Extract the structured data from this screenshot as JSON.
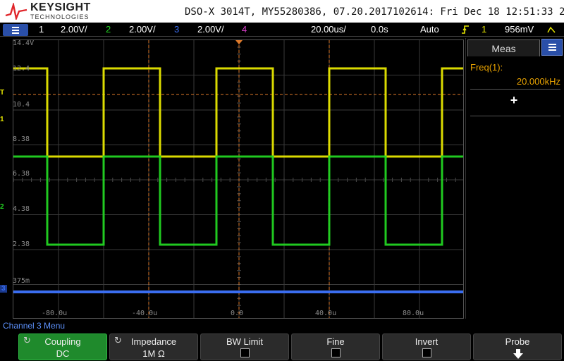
{
  "header": {
    "brand": "KEYSIGHT",
    "brand_sub": "TECHNOLOGIES",
    "title": "DSO-X 3014T, MY55280386, 07.20.2017102614: Fri Dec 18 12:51:33 2020"
  },
  "status": {
    "ch1_num": "1",
    "ch1_scale": "2.00V/",
    "ch2_num": "2",
    "ch2_scale": "2.00V/",
    "ch3_num": "3",
    "ch3_scale": "2.00V/",
    "ch4_num": "4",
    "timebase": "20.00us/",
    "delay": "0.0s",
    "trigger_mode": "Auto",
    "trigger_icon": "trigger-edge-icon",
    "trigger_source": "1",
    "trigger_level": "956mV"
  },
  "colors": {
    "ch1": "#e6e600",
    "ch2": "#22d422",
    "ch3": "#3a6df0",
    "ch4": "#e040d0",
    "accent": "#e8a200",
    "menu_blue": "#2a4fa8"
  },
  "graticule": {
    "y_labels": [
      "14.4V",
      "12.4",
      "10.4",
      "8.38",
      "6.38",
      "4.38",
      "2.38",
      "375m"
    ],
    "x_labels": [
      "-80.0u",
      "-40.0u",
      "0.0",
      "40.0u",
      "80.0u"
    ],
    "trigger_marker": "T",
    "ch1_marker": "1",
    "ch2_marker": "2",
    "ch3_marker": "3"
  },
  "chart_data": {
    "type": "line",
    "x_unit": "us",
    "xlim": [
      -100,
      100
    ],
    "series": [
      {
        "name": "1",
        "high": 12.4,
        "low": 7.4
      },
      {
        "name": "2",
        "high": 7.4,
        "low": 2.4
      },
      {
        "name": "3",
        "level": -0.6
      }
    ],
    "period_us": 50,
    "first_rising_edge_us": -60
  },
  "measurement": {
    "tab": "Meas",
    "label": "Freq(1):",
    "value": "20.000kHz",
    "add_symbol": "+"
  },
  "menu": {
    "title": "Channel 3 Menu",
    "coupling_label": "Coupling",
    "coupling_value": "DC",
    "impedance_label": "Impedance",
    "impedance_value": "1M Ω",
    "bwlimit_label": "BW Limit",
    "fine_label": "Fine",
    "invert_label": "Invert",
    "probe_label": "Probe"
  }
}
